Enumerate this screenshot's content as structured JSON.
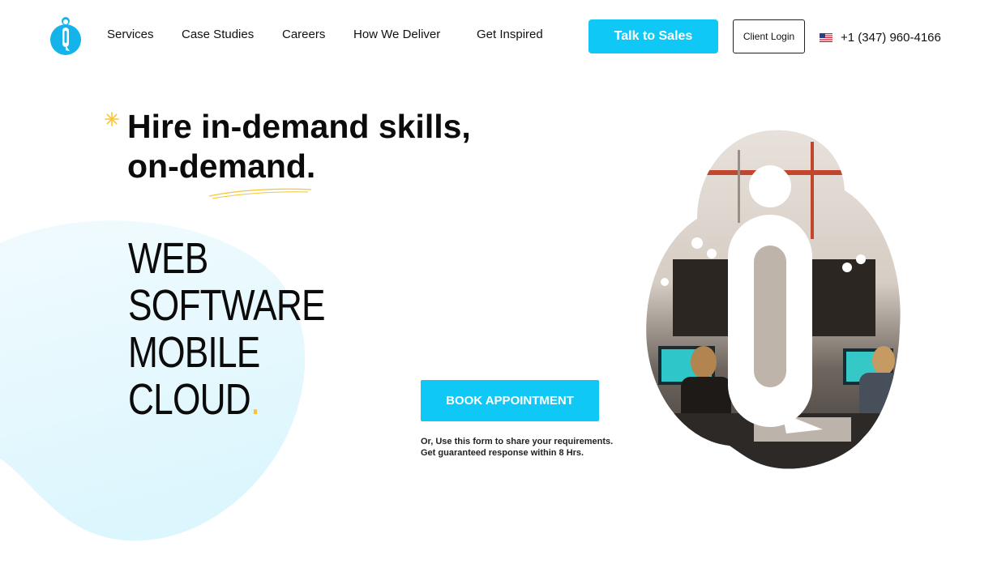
{
  "brand": {
    "logo_icon": "q-logo-icon",
    "accent_color": "#0fc8f5",
    "highlight_color": "#f7c531"
  },
  "nav": {
    "items": [
      {
        "label": "Services"
      },
      {
        "label": "Case Studies"
      },
      {
        "label": "Careers"
      },
      {
        "label": "How We Deliver"
      },
      {
        "label": "Get Inspired"
      }
    ],
    "sales_button": "Talk to Sales",
    "login_button": "Client Login",
    "phone": "+1 (347) 960-4166",
    "flag_icon": "us-flag-icon"
  },
  "hero": {
    "title_line1": "Hire in-demand skills,",
    "title_line2": "on-demand.",
    "services": [
      "WEB",
      "SOFTWARE",
      "MOBILE",
      "CLOUD"
    ],
    "services_dot": ".",
    "book_button": "BOOK APPOINTMENT",
    "note_line1": "Or, Use this form to share your requirements.",
    "note_line2": "Get guaranteed response within 8 Hrs."
  }
}
